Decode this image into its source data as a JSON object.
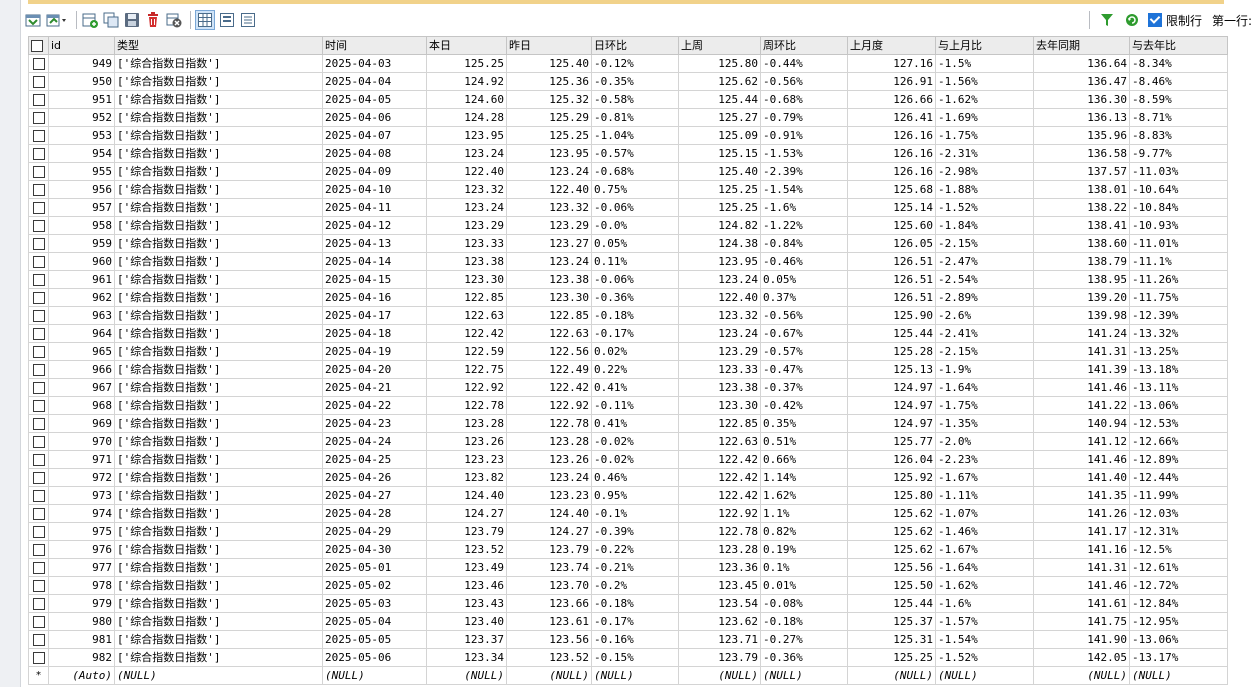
{
  "toolbar": {
    "limit_label": "限制行",
    "first_row_label": "第一行:"
  },
  "columns": [
    "id",
    "类型",
    "时间",
    "本日",
    "昨日",
    "日环比",
    "上周",
    "周环比",
    "上月度",
    "与上月比",
    "去年同期",
    "与去年比"
  ],
  "rows": [
    [
      "949",
      "['综合指数日指数']",
      "2025-04-03",
      "125.25",
      "125.40",
      "-0.12%",
      "125.80",
      "-0.44%",
      "127.16",
      "-1.5%",
      "136.64",
      "-8.34%"
    ],
    [
      "950",
      "['综合指数日指数']",
      "2025-04-04",
      "124.92",
      "125.36",
      "-0.35%",
      "125.62",
      "-0.56%",
      "126.91",
      "-1.56%",
      "136.47",
      "-8.46%"
    ],
    [
      "951",
      "['综合指数日指数']",
      "2025-04-05",
      "124.60",
      "125.32",
      "-0.58%",
      "125.44",
      "-0.68%",
      "126.66",
      "-1.62%",
      "136.30",
      "-8.59%"
    ],
    [
      "952",
      "['综合指数日指数']",
      "2025-04-06",
      "124.28",
      "125.29",
      "-0.81%",
      "125.27",
      "-0.79%",
      "126.41",
      "-1.69%",
      "136.13",
      "-8.71%"
    ],
    [
      "953",
      "['综合指数日指数']",
      "2025-04-07",
      "123.95",
      "125.25",
      "-1.04%",
      "125.09",
      "-0.91%",
      "126.16",
      "-1.75%",
      "135.96",
      "-8.83%"
    ],
    [
      "954",
      "['综合指数日指数']",
      "2025-04-08",
      "123.24",
      "123.95",
      "-0.57%",
      "125.15",
      "-1.53%",
      "126.16",
      "-2.31%",
      "136.58",
      "-9.77%"
    ],
    [
      "955",
      "['综合指数日指数']",
      "2025-04-09",
      "122.40",
      "123.24",
      "-0.68%",
      "125.40",
      "-2.39%",
      "126.16",
      "-2.98%",
      "137.57",
      "-11.03%"
    ],
    [
      "956",
      "['综合指数日指数']",
      "2025-04-10",
      "123.32",
      "122.40",
      "0.75%",
      "125.25",
      "-1.54%",
      "125.68",
      "-1.88%",
      "138.01",
      "-10.64%"
    ],
    [
      "957",
      "['综合指数日指数']",
      "2025-04-11",
      "123.24",
      "123.32",
      "-0.06%",
      "125.25",
      "-1.6%",
      "125.14",
      "-1.52%",
      "138.22",
      "-10.84%"
    ],
    [
      "958",
      "['综合指数日指数']",
      "2025-04-12",
      "123.29",
      "123.29",
      "-0.0%",
      "124.82",
      "-1.22%",
      "125.60",
      "-1.84%",
      "138.41",
      "-10.93%"
    ],
    [
      "959",
      "['综合指数日指数']",
      "2025-04-13",
      "123.33",
      "123.27",
      "0.05%",
      "124.38",
      "-0.84%",
      "126.05",
      "-2.15%",
      "138.60",
      "-11.01%"
    ],
    [
      "960",
      "['综合指数日指数']",
      "2025-04-14",
      "123.38",
      "123.24",
      "0.11%",
      "123.95",
      "-0.46%",
      "126.51",
      "-2.47%",
      "138.79",
      "-11.1%"
    ],
    [
      "961",
      "['综合指数日指数']",
      "2025-04-15",
      "123.30",
      "123.38",
      "-0.06%",
      "123.24",
      "0.05%",
      "126.51",
      "-2.54%",
      "138.95",
      "-11.26%"
    ],
    [
      "962",
      "['综合指数日指数']",
      "2025-04-16",
      "122.85",
      "123.30",
      "-0.36%",
      "122.40",
      "0.37%",
      "126.51",
      "-2.89%",
      "139.20",
      "-11.75%"
    ],
    [
      "963",
      "['综合指数日指数']",
      "2025-04-17",
      "122.63",
      "122.85",
      "-0.18%",
      "123.32",
      "-0.56%",
      "125.90",
      "-2.6%",
      "139.98",
      "-12.39%"
    ],
    [
      "964",
      "['综合指数日指数']",
      "2025-04-18",
      "122.42",
      "122.63",
      "-0.17%",
      "123.24",
      "-0.67%",
      "125.44",
      "-2.41%",
      "141.24",
      "-13.32%"
    ],
    [
      "965",
      "['综合指数日指数']",
      "2025-04-19",
      "122.59",
      "122.56",
      "0.02%",
      "123.29",
      "-0.57%",
      "125.28",
      "-2.15%",
      "141.31",
      "-13.25%"
    ],
    [
      "966",
      "['综合指数日指数']",
      "2025-04-20",
      "122.75",
      "122.49",
      "0.22%",
      "123.33",
      "-0.47%",
      "125.13",
      "-1.9%",
      "141.39",
      "-13.18%"
    ],
    [
      "967",
      "['综合指数日指数']",
      "2025-04-21",
      "122.92",
      "122.42",
      "0.41%",
      "123.38",
      "-0.37%",
      "124.97",
      "-1.64%",
      "141.46",
      "-13.11%"
    ],
    [
      "968",
      "['综合指数日指数']",
      "2025-04-22",
      "122.78",
      "122.92",
      "-0.11%",
      "123.30",
      "-0.42%",
      "124.97",
      "-1.75%",
      "141.22",
      "-13.06%"
    ],
    [
      "969",
      "['综合指数日指数']",
      "2025-04-23",
      "123.28",
      "122.78",
      "0.41%",
      "122.85",
      "0.35%",
      "124.97",
      "-1.35%",
      "140.94",
      "-12.53%"
    ],
    [
      "970",
      "['综合指数日指数']",
      "2025-04-24",
      "123.26",
      "123.28",
      "-0.02%",
      "122.63",
      "0.51%",
      "125.77",
      "-2.0%",
      "141.12",
      "-12.66%"
    ],
    [
      "971",
      "['综合指数日指数']",
      "2025-04-25",
      "123.23",
      "123.26",
      "-0.02%",
      "122.42",
      "0.66%",
      "126.04",
      "-2.23%",
      "141.46",
      "-12.89%"
    ],
    [
      "972",
      "['综合指数日指数']",
      "2025-04-26",
      "123.82",
      "123.24",
      "0.46%",
      "122.42",
      "1.14%",
      "125.92",
      "-1.67%",
      "141.40",
      "-12.44%"
    ],
    [
      "973",
      "['综合指数日指数']",
      "2025-04-27",
      "124.40",
      "123.23",
      "0.95%",
      "122.42",
      "1.62%",
      "125.80",
      "-1.11%",
      "141.35",
      "-11.99%"
    ],
    [
      "974",
      "['综合指数日指数']",
      "2025-04-28",
      "124.27",
      "124.40",
      "-0.1%",
      "122.92",
      "1.1%",
      "125.62",
      "-1.07%",
      "141.26",
      "-12.03%"
    ],
    [
      "975",
      "['综合指数日指数']",
      "2025-04-29",
      "123.79",
      "124.27",
      "-0.39%",
      "122.78",
      "0.82%",
      "125.62",
      "-1.46%",
      "141.17",
      "-12.31%"
    ],
    [
      "976",
      "['综合指数日指数']",
      "2025-04-30",
      "123.52",
      "123.79",
      "-0.22%",
      "123.28",
      "0.19%",
      "125.62",
      "-1.67%",
      "141.16",
      "-12.5%"
    ],
    [
      "977",
      "['综合指数日指数']",
      "2025-05-01",
      "123.49",
      "123.74",
      "-0.21%",
      "123.36",
      "0.1%",
      "125.56",
      "-1.64%",
      "141.31",
      "-12.61%"
    ],
    [
      "978",
      "['综合指数日指数']",
      "2025-05-02",
      "123.46",
      "123.70",
      "-0.2%",
      "123.45",
      "0.01%",
      "125.50",
      "-1.62%",
      "141.46",
      "-12.72%"
    ],
    [
      "979",
      "['综合指数日指数']",
      "2025-05-03",
      "123.43",
      "123.66",
      "-0.18%",
      "123.54",
      "-0.08%",
      "125.44",
      "-1.6%",
      "141.61",
      "-12.84%"
    ],
    [
      "980",
      "['综合指数日指数']",
      "2025-05-04",
      "123.40",
      "123.61",
      "-0.17%",
      "123.62",
      "-0.18%",
      "125.37",
      "-1.57%",
      "141.75",
      "-12.95%"
    ],
    [
      "981",
      "['综合指数日指数']",
      "2025-05-05",
      "123.37",
      "123.56",
      "-0.16%",
      "123.71",
      "-0.27%",
      "125.31",
      "-1.54%",
      "141.90",
      "-13.06%"
    ],
    [
      "982",
      "['综合指数日指数']",
      "2025-05-06",
      "123.34",
      "123.52",
      "-0.15%",
      "123.79",
      "-0.36%",
      "125.25",
      "-1.52%",
      "142.05",
      "-13.17%"
    ]
  ],
  "new_row": {
    "marker": "*",
    "id": "(Auto)",
    "null_text": "(NULL)"
  },
  "colors": {
    "header_bg": "#ececec",
    "grid_line": "#d4d4d4",
    "accent": "#1e73d8"
  }
}
